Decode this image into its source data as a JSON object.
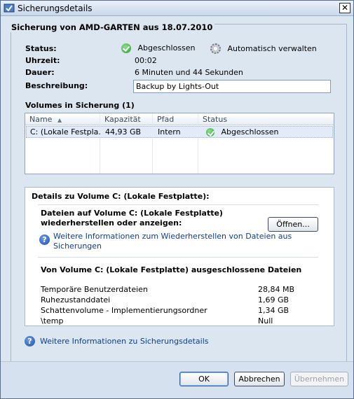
{
  "window": {
    "title": "Sicherungsdetails",
    "close_glyph": "✕"
  },
  "group": {
    "legend": "Sicherung von AMD-GARTEN aus 18.07.2010",
    "status_label": "Status:",
    "status_value": "Abgeschlossen",
    "managed_label": "Automatisch verwalten",
    "time_label": "Uhrzeit:",
    "time_value": "00:02",
    "duration_label": "Dauer:",
    "duration_value": "6 Minuten und 44 Sekunden",
    "description_label": "Beschreibung:",
    "description_value": "Backup by Lights-Out"
  },
  "volumes": {
    "heading": "Volumes in Sicherung (1)",
    "columns": [
      "Name",
      "Kapazität",
      "Pfad",
      "Status"
    ],
    "sort_glyph": "▲",
    "rows": [
      {
        "name": "C: (Lokale Festpla...",
        "capacity": "44,93 GB",
        "path": "Intern",
        "status": "Abgeschlossen"
      }
    ]
  },
  "details": {
    "heading": "Details zu Volume C: (Lokale Festplatte):",
    "restore_line1": "Dateien auf Volume C: (Lokale Festplatte)",
    "restore_line2": "wiederherstellen oder anzeigen:",
    "open_button": "Öffnen...",
    "info_link_line1": "Weitere Informationen zum Wiederherstellen von Dateien aus",
    "info_link_line2": "Sicherungen",
    "excluded_heading": "Von Volume C: (Lokale Festplatte) ausgeschlossene Dateien",
    "excluded": [
      {
        "name": "Temporäre Benutzerdateien",
        "size": "28,84 MB"
      },
      {
        "name": "Ruhezustanddatei",
        "size": "1,69 GB"
      },
      {
        "name": "Schattenvolume - Implementierungsordner",
        "size": "1,34 GB"
      },
      {
        "name": "\\temp",
        "size": "Null"
      }
    ]
  },
  "footer_link": "Weitere Informationen zu Sicherungsdetails",
  "buttons": {
    "ok": "OK",
    "cancel": "Abbrechen",
    "apply": "Übernehmen"
  },
  "colors": {
    "accent_link": "#0b3e8c",
    "status_ok": "#2f9a2f",
    "dialog_bg": "#dce6f1"
  }
}
